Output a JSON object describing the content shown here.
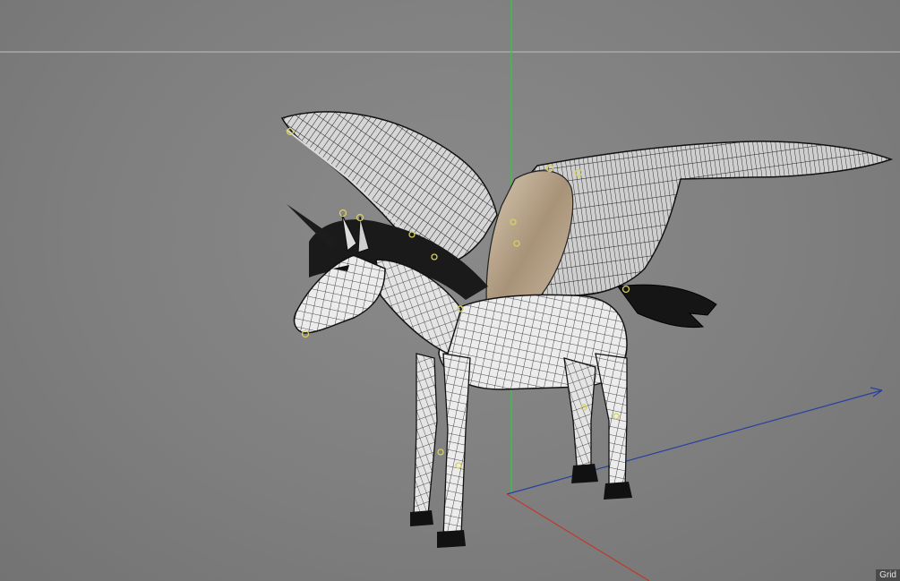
{
  "viewport": {
    "grid_label": "Grid",
    "colors": {
      "background": "#808080",
      "horizon": "#a9a9a9",
      "axis_x": "#c0392b",
      "axis_y": "#2ecc40",
      "axis_z": "#2a3fa0",
      "mesh_fill": "#ececec",
      "mesh_wire": "#1a1a1a",
      "rig_joint": "#d8d060",
      "wing_membrane": "#b9a58f"
    },
    "model": {
      "kind": "winged-unicorn-wireframe",
      "icon": "pegasus-mesh-icon"
    }
  }
}
